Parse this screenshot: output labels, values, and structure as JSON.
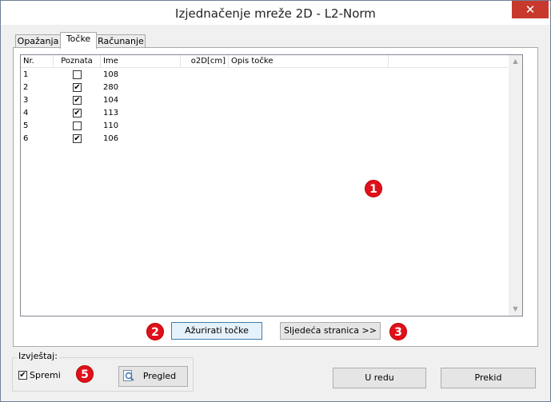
{
  "window": {
    "title": "Izjednačenje mreže 2D - L2-Norm",
    "close_label": "✕"
  },
  "tabs": [
    {
      "label": "Opažanja"
    },
    {
      "label": "Točke"
    },
    {
      "label": "Računanje"
    }
  ],
  "table": {
    "columns": [
      "Nr.",
      "Poznata",
      "Ime",
      "o2D[cm]",
      "Opis točke"
    ],
    "rows": [
      {
        "nr": "1",
        "known": false,
        "name": "108"
      },
      {
        "nr": "2",
        "known": true,
        "name": "280"
      },
      {
        "nr": "3",
        "known": true,
        "name": "104"
      },
      {
        "nr": "4",
        "known": true,
        "name": "113"
      },
      {
        "nr": "5",
        "known": false,
        "name": "110"
      },
      {
        "nr": "6",
        "known": true,
        "name": "106"
      }
    ]
  },
  "buttons": {
    "update": "Ažurirati točke",
    "next_page": "Sljedeća stranica >>",
    "preview": "Pregled",
    "ok": "U redu",
    "cancel": "Prekid"
  },
  "report": {
    "group_label": "Izvještaj:",
    "save_label": "Spremi",
    "save_checked": true
  },
  "markers": [
    "1",
    "2",
    "3",
    "5"
  ],
  "colors": {
    "marker": "#e0101a",
    "close_button": "#c7392d",
    "focus_border": "#3c7fb1"
  }
}
